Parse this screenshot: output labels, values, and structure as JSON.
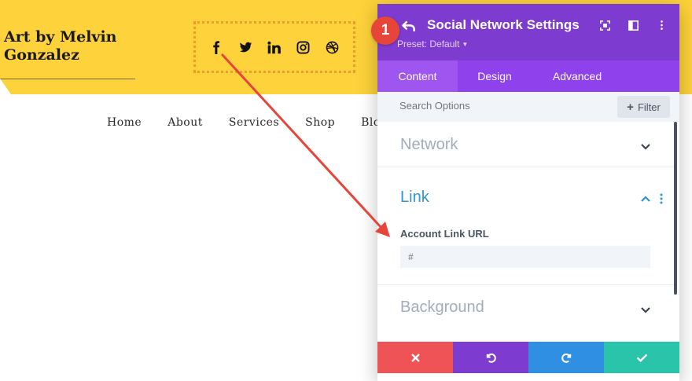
{
  "site": {
    "title": "Art by Melvin Gonzalez",
    "social_icons": [
      "facebook-icon",
      "twitter-icon",
      "linkedin-icon",
      "instagram-icon",
      "dribbble-icon"
    ],
    "nav": [
      "Home",
      "About",
      "Services",
      "Shop",
      "Blog"
    ],
    "colors": {
      "header": "#fdd23a",
      "selection_border": "#f39a2f"
    }
  },
  "annotation": {
    "badge": "1",
    "color": "#e7453a"
  },
  "panel": {
    "title": "Social Network Settings",
    "preset_label": "Preset: Default",
    "tabs": [
      "Content",
      "Design",
      "Advanced"
    ],
    "active_tab": "Content",
    "search": {
      "placeholder": "Search Options",
      "filter_label": "Filter"
    },
    "sections": {
      "network": {
        "title": "Network",
        "expanded": false
      },
      "link": {
        "title": "Link",
        "expanded": true,
        "field_label": "Account Link URL",
        "field_placeholder": "#"
      },
      "background": {
        "title": "Background",
        "expanded": false
      }
    },
    "footer": [
      "discard",
      "undo",
      "redo",
      "save"
    ],
    "colors": {
      "header": "#7e3bd0",
      "tabs": "#8f42ec",
      "active_tab": "#9f55f0",
      "accent_text": "#2e96d2",
      "discard": "#ef5355",
      "undo": "#7e3bd0",
      "redo": "#2e8fe3",
      "save": "#29c4a9"
    }
  }
}
